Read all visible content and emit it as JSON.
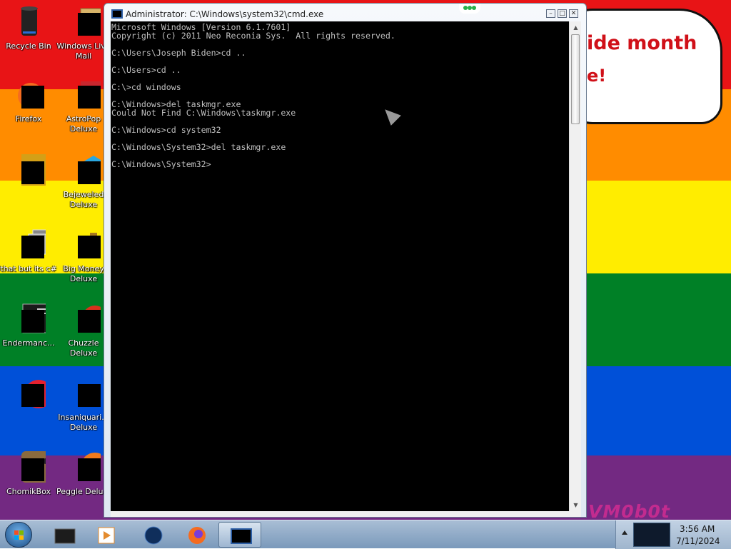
{
  "desktop": {
    "wallpaper": {
      "colors": [
        "#e81416",
        "#ff8c00",
        "#ffed00",
        "#008026",
        "#0050d8",
        "#732982"
      ]
    },
    "bubble": {
      "line1": "ide month",
      "line2": "e!"
    },
    "watermark": "VM0b0t",
    "icons": {
      "recycle_bin": "Recycle Bin",
      "windows_live_mail": "Windows Live Mail",
      "firefox": "Firefox",
      "astropop": "AstroPop Deluxe",
      "bejeweled": "Bejeweled Deluxe",
      "thatbut": "that but its c#",
      "bigmoney": "Big Money Deluxe",
      "endermanc": "Endermanc...",
      "chuzzle": "Chuzzle Deluxe",
      "insaniquarium": "Insaniquari... Deluxe",
      "chomikbox": "ChomikBox",
      "peggle": "Peggle Delu..."
    }
  },
  "cmd": {
    "title": "Administrator: C:\\Windows\\system32\\cmd.exe",
    "lines": [
      "Microsoft Windows [Version 6.1.7601]",
      "Copyright (c) 2011 Neo Reconia Sys.  All rights reserved.",
      "",
      "C:\\Users\\Joseph Biden>cd ..",
      "",
      "C:\\Users>cd ..",
      "",
      "C:\\>cd windows",
      "",
      "C:\\Windows>del taskmgr.exe",
      "Could Not Find C:\\Windows\\taskmgr.exe",
      "",
      "C:\\Windows>cd system32",
      "",
      "C:\\Windows\\System32>del taskmgr.exe",
      "",
      "C:\\Windows\\System32>"
    ]
  },
  "taskbar": {
    "items": [
      "console-window",
      "media-player",
      "network",
      "firefox",
      "cmd"
    ],
    "clock": {
      "time": "3:56 AM",
      "date": "7/11/2024"
    }
  }
}
